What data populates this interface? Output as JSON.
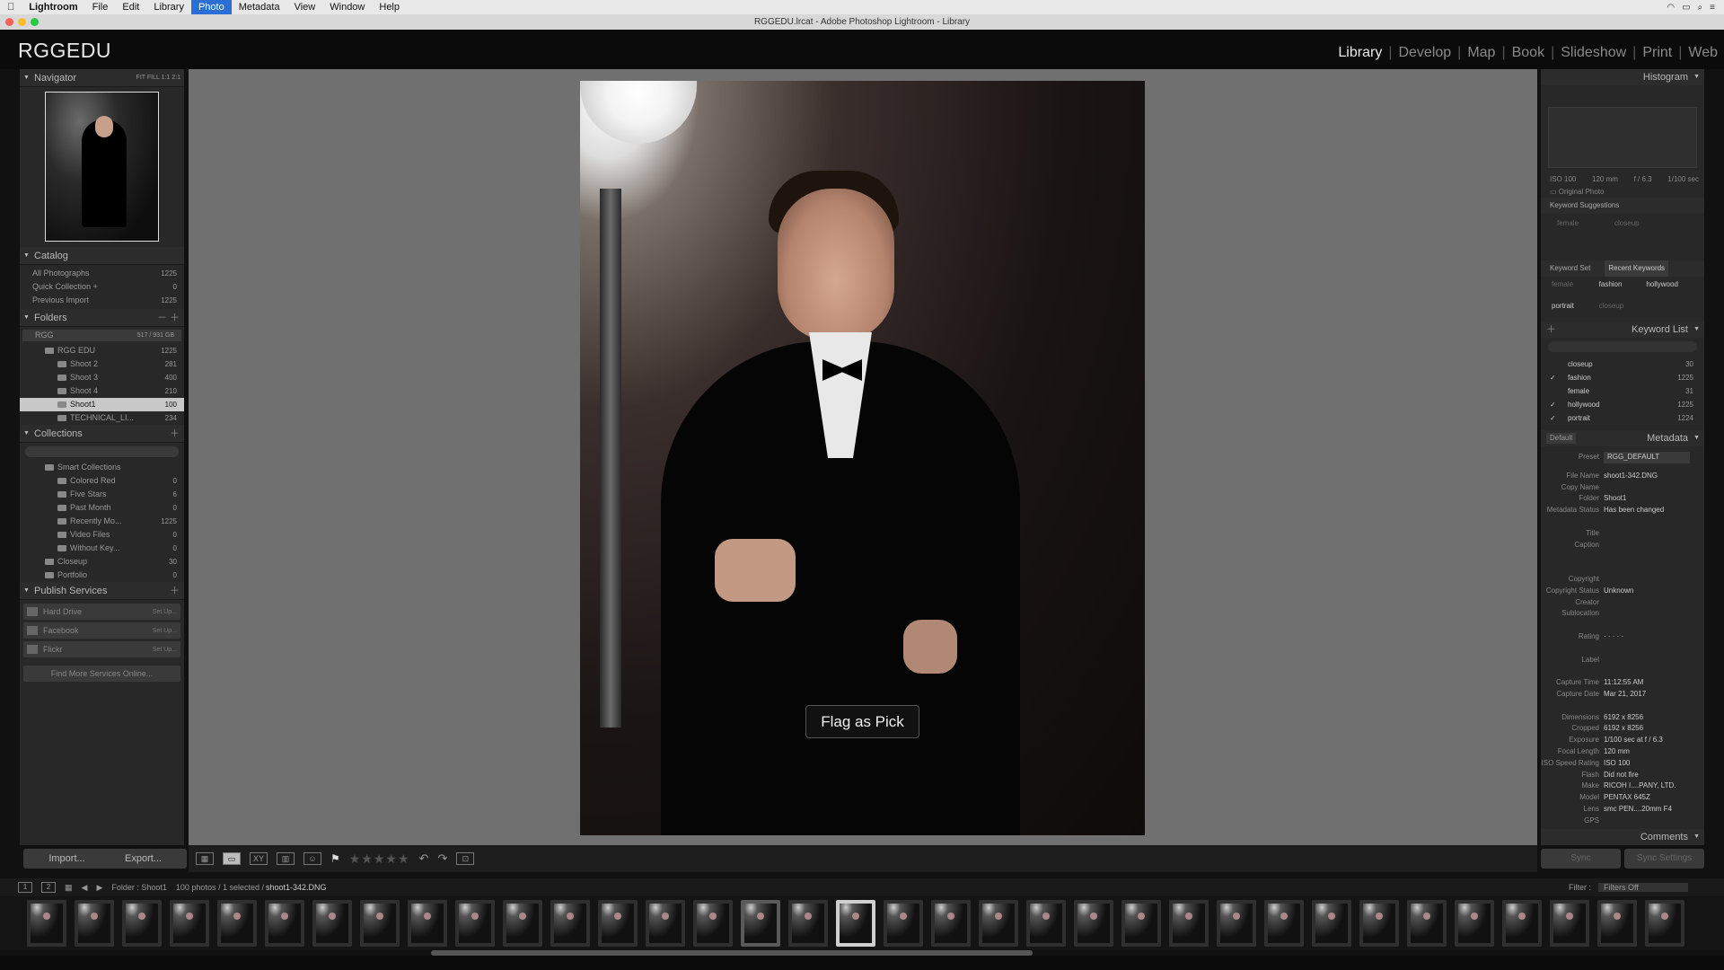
{
  "menubar": {
    "app": "Lightroom",
    "items": [
      "File",
      "Edit",
      "Library",
      "Photo",
      "Metadata",
      "View",
      "Window",
      "Help"
    ],
    "active": "Photo"
  },
  "window": {
    "title": "RGGEDU.lrcat - Adobe Photoshop Lightroom - Library"
  },
  "identity": {
    "brand": "RGGEDU"
  },
  "modules": [
    "Library",
    "Develop",
    "Map",
    "Book",
    "Slideshow",
    "Print",
    "Web"
  ],
  "navigator": {
    "title": "Navigator",
    "zoom": [
      "FIT",
      "FILL",
      "1:1",
      "2:1"
    ]
  },
  "catalog": {
    "title": "Catalog",
    "items": [
      {
        "label": "All Photographs",
        "count": "1225"
      },
      {
        "label": "Quick Collection +",
        "count": "0"
      },
      {
        "label": "Previous Import",
        "count": "1225"
      }
    ]
  },
  "folders": {
    "title": "Folders",
    "volume": {
      "label": "RGG",
      "size": "517 / 931 GB"
    },
    "items": [
      {
        "label": "RGG EDU",
        "count": "1225",
        "indent": 1
      },
      {
        "label": "Shoot 2",
        "count": "281",
        "indent": 2
      },
      {
        "label": "Shoot 3",
        "count": "400",
        "indent": 2
      },
      {
        "label": "Shoot 4",
        "count": "210",
        "indent": 2
      },
      {
        "label": "Shoot1",
        "count": "100",
        "indent": 2,
        "selected": true
      },
      {
        "label": "TECHNICAL_LI...",
        "count": "234",
        "indent": 2
      }
    ]
  },
  "collections": {
    "title": "Collections",
    "items": [
      {
        "label": "Smart Collections",
        "count": "",
        "indent": 1
      },
      {
        "label": "Colored Red",
        "count": "0",
        "indent": 2
      },
      {
        "label": "Five Stars",
        "count": "6",
        "indent": 2
      },
      {
        "label": "Past Month",
        "count": "0",
        "indent": 2
      },
      {
        "label": "Recently Mo...",
        "count": "1225",
        "indent": 2
      },
      {
        "label": "Video Files",
        "count": "0",
        "indent": 2
      },
      {
        "label": "Without Key...",
        "count": "0",
        "indent": 2
      },
      {
        "label": "Closeup",
        "count": "30",
        "indent": 1
      },
      {
        "label": "Portfolio",
        "count": "0",
        "indent": 1
      }
    ]
  },
  "publish": {
    "title": "Publish Services",
    "items": [
      {
        "label": "Hard Drive",
        "action": "Set Up..."
      },
      {
        "label": "Facebook",
        "action": "Set Up..."
      },
      {
        "label": "Flickr",
        "action": "Set Up..."
      }
    ],
    "find_more": "Find More Services Online..."
  },
  "import_label": "Import...",
  "export_label": "Export...",
  "toast": "Flag as Pick",
  "histogram": {
    "title": "Histogram",
    "iso": "ISO 100",
    "focal": "120 mm",
    "aperture": "f / 6.3",
    "shutter": "1/100 sec",
    "original": "Original Photo"
  },
  "keyword_suggestions": {
    "title": "Keyword Suggestions",
    "items": [
      "female",
      "closeup"
    ]
  },
  "keyword_set": {
    "title": "Keyword Set",
    "preset": "Recent Keywords",
    "items": [
      "female",
      "fashion",
      "hollywood",
      "portrait",
      "closeup"
    ]
  },
  "keyword_list": {
    "title": "Keyword List",
    "items": [
      {
        "label": "closeup",
        "count": "30",
        "checked": false
      },
      {
        "label": "fashion",
        "count": "1225",
        "checked": true
      },
      {
        "label": "female",
        "count": "31",
        "checked": false
      },
      {
        "label": "hollywood",
        "count": "1225",
        "checked": true
      },
      {
        "label": "portrait",
        "count": "1224",
        "checked": true
      }
    ]
  },
  "metadata": {
    "title": "Metadata",
    "default": "Default",
    "preset_label": "Preset",
    "preset": "RGG_DEFAULT",
    "fields": [
      {
        "k": "File Name",
        "v": "shoot1-342.DNG"
      },
      {
        "k": "Copy Name",
        "v": ""
      },
      {
        "k": "Folder",
        "v": "Shoot1"
      },
      {
        "k": "Metadata Status",
        "v": "Has been changed"
      },
      {
        "k": "",
        "v": ""
      },
      {
        "k": "Title",
        "v": ""
      },
      {
        "k": "Caption",
        "v": ""
      },
      {
        "k": "",
        "v": ""
      },
      {
        "k": "",
        "v": ""
      },
      {
        "k": "Copyright",
        "v": ""
      },
      {
        "k": "Copyright Status",
        "v": "Unknown"
      },
      {
        "k": "Creator",
        "v": ""
      },
      {
        "k": "Sublocation",
        "v": ""
      },
      {
        "k": "",
        "v": ""
      },
      {
        "k": "Rating",
        "v": "· · · · ·"
      },
      {
        "k": "",
        "v": ""
      },
      {
        "k": "Label",
        "v": ""
      },
      {
        "k": "",
        "v": ""
      },
      {
        "k": "Capture Time",
        "v": "11:12:55 AM"
      },
      {
        "k": "Capture Date",
        "v": "Mar 21, 2017"
      },
      {
        "k": "",
        "v": ""
      },
      {
        "k": "Dimensions",
        "v": "6192 x 8256"
      },
      {
        "k": "Cropped",
        "v": "6192 x 8256"
      },
      {
        "k": "Exposure",
        "v": "1/100 sec at f / 6.3"
      },
      {
        "k": "Focal Length",
        "v": "120 mm"
      },
      {
        "k": "ISO Speed Rating",
        "v": "ISO 100"
      },
      {
        "k": "Flash",
        "v": "Did not fire"
      },
      {
        "k": "Make",
        "v": "RICOH I....PANY, LTD."
      },
      {
        "k": "Model",
        "v": "PENTAX 645Z"
      },
      {
        "k": "Lens",
        "v": "smc PEN....20mm F4"
      },
      {
        "k": "GPS",
        "v": ""
      }
    ]
  },
  "comments": {
    "title": "Comments"
  },
  "sync": {
    "sync_label": "Sync",
    "sync_settings": "Sync Settings"
  },
  "filmstrip": {
    "folder": "Folder : Shoot1",
    "count": "100 photos / 1 selected /",
    "file": "shoot1-342.DNG",
    "filter_label": "Filter :",
    "filter_value": "Filters Off",
    "count_thumbs": 35,
    "selected_index": 17,
    "highlight_index": 15
  }
}
